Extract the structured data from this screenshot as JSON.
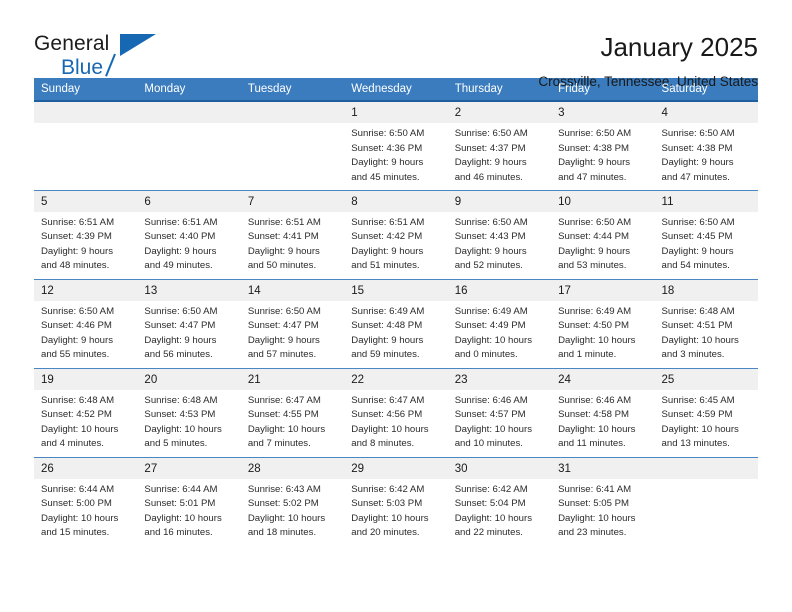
{
  "brand": {
    "line1": "General",
    "line2": "Blue",
    "accent_color": "#1668b3",
    "logo_icon": "triangle-flag-icon"
  },
  "header": {
    "title": "January 2025",
    "subtitle": "Crossville, Tennessee, United States"
  },
  "theme": {
    "header_bg": "#3a7cbe",
    "header_rule": "#1f5f9e",
    "row_rule": "#4a86c4",
    "daynum_bg": "#f0f0f0",
    "text": "#1a1a1a"
  },
  "columns": [
    "Sunday",
    "Monday",
    "Tuesday",
    "Wednesday",
    "Thursday",
    "Friday",
    "Saturday"
  ],
  "weeks": [
    [
      {
        "day": "",
        "blank": true
      },
      {
        "day": "",
        "blank": true
      },
      {
        "day": "",
        "blank": true
      },
      {
        "day": "1",
        "sunrise": "Sunrise: 6:50 AM",
        "sunset": "Sunset: 4:36 PM",
        "daylight1": "Daylight: 9 hours",
        "daylight2": "and 45 minutes."
      },
      {
        "day": "2",
        "sunrise": "Sunrise: 6:50 AM",
        "sunset": "Sunset: 4:37 PM",
        "daylight1": "Daylight: 9 hours",
        "daylight2": "and 46 minutes."
      },
      {
        "day": "3",
        "sunrise": "Sunrise: 6:50 AM",
        "sunset": "Sunset: 4:38 PM",
        "daylight1": "Daylight: 9 hours",
        "daylight2": "and 47 minutes."
      },
      {
        "day": "4",
        "sunrise": "Sunrise: 6:50 AM",
        "sunset": "Sunset: 4:38 PM",
        "daylight1": "Daylight: 9 hours",
        "daylight2": "and 47 minutes."
      }
    ],
    [
      {
        "day": "5",
        "sunrise": "Sunrise: 6:51 AM",
        "sunset": "Sunset: 4:39 PM",
        "daylight1": "Daylight: 9 hours",
        "daylight2": "and 48 minutes."
      },
      {
        "day": "6",
        "sunrise": "Sunrise: 6:51 AM",
        "sunset": "Sunset: 4:40 PM",
        "daylight1": "Daylight: 9 hours",
        "daylight2": "and 49 minutes."
      },
      {
        "day": "7",
        "sunrise": "Sunrise: 6:51 AM",
        "sunset": "Sunset: 4:41 PM",
        "daylight1": "Daylight: 9 hours",
        "daylight2": "and 50 minutes."
      },
      {
        "day": "8",
        "sunrise": "Sunrise: 6:51 AM",
        "sunset": "Sunset: 4:42 PM",
        "daylight1": "Daylight: 9 hours",
        "daylight2": "and 51 minutes."
      },
      {
        "day": "9",
        "sunrise": "Sunrise: 6:50 AM",
        "sunset": "Sunset: 4:43 PM",
        "daylight1": "Daylight: 9 hours",
        "daylight2": "and 52 minutes."
      },
      {
        "day": "10",
        "sunrise": "Sunrise: 6:50 AM",
        "sunset": "Sunset: 4:44 PM",
        "daylight1": "Daylight: 9 hours",
        "daylight2": "and 53 minutes."
      },
      {
        "day": "11",
        "sunrise": "Sunrise: 6:50 AM",
        "sunset": "Sunset: 4:45 PM",
        "daylight1": "Daylight: 9 hours",
        "daylight2": "and 54 minutes."
      }
    ],
    [
      {
        "day": "12",
        "sunrise": "Sunrise: 6:50 AM",
        "sunset": "Sunset: 4:46 PM",
        "daylight1": "Daylight: 9 hours",
        "daylight2": "and 55 minutes."
      },
      {
        "day": "13",
        "sunrise": "Sunrise: 6:50 AM",
        "sunset": "Sunset: 4:47 PM",
        "daylight1": "Daylight: 9 hours",
        "daylight2": "and 56 minutes."
      },
      {
        "day": "14",
        "sunrise": "Sunrise: 6:50 AM",
        "sunset": "Sunset: 4:47 PM",
        "daylight1": "Daylight: 9 hours",
        "daylight2": "and 57 minutes."
      },
      {
        "day": "15",
        "sunrise": "Sunrise: 6:49 AM",
        "sunset": "Sunset: 4:48 PM",
        "daylight1": "Daylight: 9 hours",
        "daylight2": "and 59 minutes."
      },
      {
        "day": "16",
        "sunrise": "Sunrise: 6:49 AM",
        "sunset": "Sunset: 4:49 PM",
        "daylight1": "Daylight: 10 hours",
        "daylight2": "and 0 minutes."
      },
      {
        "day": "17",
        "sunrise": "Sunrise: 6:49 AM",
        "sunset": "Sunset: 4:50 PM",
        "daylight1": "Daylight: 10 hours",
        "daylight2": "and 1 minute."
      },
      {
        "day": "18",
        "sunrise": "Sunrise: 6:48 AM",
        "sunset": "Sunset: 4:51 PM",
        "daylight1": "Daylight: 10 hours",
        "daylight2": "and 3 minutes."
      }
    ],
    [
      {
        "day": "19",
        "sunrise": "Sunrise: 6:48 AM",
        "sunset": "Sunset: 4:52 PM",
        "daylight1": "Daylight: 10 hours",
        "daylight2": "and 4 minutes."
      },
      {
        "day": "20",
        "sunrise": "Sunrise: 6:48 AM",
        "sunset": "Sunset: 4:53 PM",
        "daylight1": "Daylight: 10 hours",
        "daylight2": "and 5 minutes."
      },
      {
        "day": "21",
        "sunrise": "Sunrise: 6:47 AM",
        "sunset": "Sunset: 4:55 PM",
        "daylight1": "Daylight: 10 hours",
        "daylight2": "and 7 minutes."
      },
      {
        "day": "22",
        "sunrise": "Sunrise: 6:47 AM",
        "sunset": "Sunset: 4:56 PM",
        "daylight1": "Daylight: 10 hours",
        "daylight2": "and 8 minutes."
      },
      {
        "day": "23",
        "sunrise": "Sunrise: 6:46 AM",
        "sunset": "Sunset: 4:57 PM",
        "daylight1": "Daylight: 10 hours",
        "daylight2": "and 10 minutes."
      },
      {
        "day": "24",
        "sunrise": "Sunrise: 6:46 AM",
        "sunset": "Sunset: 4:58 PM",
        "daylight1": "Daylight: 10 hours",
        "daylight2": "and 11 minutes."
      },
      {
        "day": "25",
        "sunrise": "Sunrise: 6:45 AM",
        "sunset": "Sunset: 4:59 PM",
        "daylight1": "Daylight: 10 hours",
        "daylight2": "and 13 minutes."
      }
    ],
    [
      {
        "day": "26",
        "sunrise": "Sunrise: 6:44 AM",
        "sunset": "Sunset: 5:00 PM",
        "daylight1": "Daylight: 10 hours",
        "daylight2": "and 15 minutes."
      },
      {
        "day": "27",
        "sunrise": "Sunrise: 6:44 AM",
        "sunset": "Sunset: 5:01 PM",
        "daylight1": "Daylight: 10 hours",
        "daylight2": "and 16 minutes."
      },
      {
        "day": "28",
        "sunrise": "Sunrise: 6:43 AM",
        "sunset": "Sunset: 5:02 PM",
        "daylight1": "Daylight: 10 hours",
        "daylight2": "and 18 minutes."
      },
      {
        "day": "29",
        "sunrise": "Sunrise: 6:42 AM",
        "sunset": "Sunset: 5:03 PM",
        "daylight1": "Daylight: 10 hours",
        "daylight2": "and 20 minutes."
      },
      {
        "day": "30",
        "sunrise": "Sunrise: 6:42 AM",
        "sunset": "Sunset: 5:04 PM",
        "daylight1": "Daylight: 10 hours",
        "daylight2": "and 22 minutes."
      },
      {
        "day": "31",
        "sunrise": "Sunrise: 6:41 AM",
        "sunset": "Sunset: 5:05 PM",
        "daylight1": "Daylight: 10 hours",
        "daylight2": "and 23 minutes."
      },
      {
        "day": "",
        "blank": true
      }
    ]
  ]
}
